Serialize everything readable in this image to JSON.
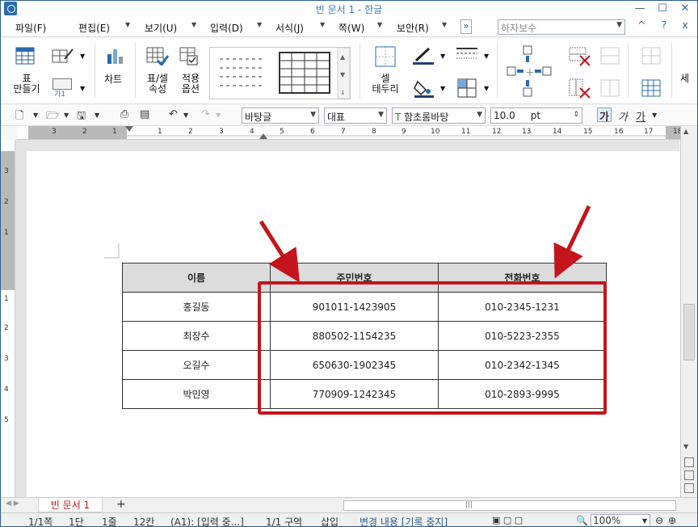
{
  "window": {
    "title": "빈 문서 1 - 한글",
    "controls": [
      "—",
      "☐",
      "✕"
    ]
  },
  "menu": {
    "items": [
      {
        "label": "파일(F)"
      },
      {
        "label": "편집(E)"
      },
      {
        "label": "보기(U)"
      },
      {
        "label": "입력(D)"
      },
      {
        "label": "서식(J)"
      },
      {
        "label": "쪽(W)"
      },
      {
        "label": "보안(R)"
      }
    ],
    "more": "»",
    "hanja_placeholder": "하자보수",
    "right_buttons": [
      "^",
      "?",
      "x"
    ]
  },
  "ribbon": {
    "table_create": "표\n만들기",
    "ga_label": "가1",
    "chart": "차트",
    "table_cell_props": "표/셀\n속성",
    "apply_options": "적용\n옵션",
    "cell_border": "셀\n테두리",
    "more": "세"
  },
  "toolbar": {
    "style": "바탕글",
    "lang": "대표",
    "font": "함초롬바탕",
    "size": "10.0",
    "unit": "pt",
    "bold": "가",
    "italic": "가",
    "underline": "가"
  },
  "ruler": {
    "h_labels": [
      "3",
      "2",
      "1",
      "1",
      "2",
      "3",
      "4",
      "5",
      "6",
      "7",
      "8",
      "9",
      "10",
      "11",
      "12",
      "13",
      "14",
      "15",
      "16",
      "17",
      "18"
    ],
    "v_labels": [
      "3",
      "2",
      "1",
      "1",
      "2",
      "3",
      "4",
      "5"
    ]
  },
  "table": {
    "headers": [
      "이름",
      "주민번호",
      "전화번호"
    ],
    "rows": [
      [
        "홍길동",
        "901011-1423905",
        "010-2345-1231"
      ],
      [
        "최장수",
        "880502-1154235",
        "010-5223-2355"
      ],
      [
        "오길수",
        "650630-1902345",
        "010-2342-1345"
      ],
      [
        "박민영",
        "770909-1242345",
        "010-2893-9995"
      ]
    ]
  },
  "annotation": {
    "box_color": "#c4151c",
    "arrow_color": "#c4151c"
  },
  "tabs": {
    "doc": "빈 문서 1",
    "add": "+"
  },
  "status": {
    "page": "1/1쪽",
    "column": "1단",
    "line": "1줄",
    "col": "12칸",
    "cell": "(A1): [입력 중...]",
    "section": "1/1 구역",
    "insert": "삽입",
    "track": "변경 내용 [기록 중지]",
    "zoom": "100%"
  }
}
